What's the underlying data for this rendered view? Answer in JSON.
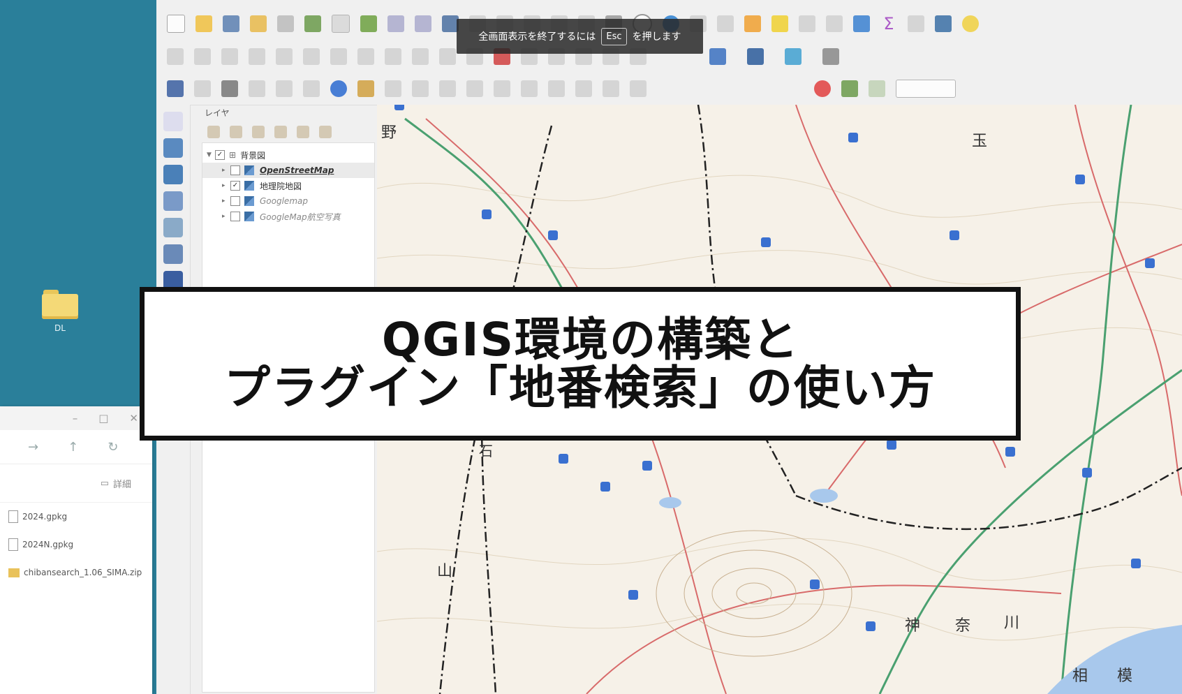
{
  "desktop": {
    "folder_label": "DL"
  },
  "explorer": {
    "window_buttons": [
      "–",
      "□",
      "✕"
    ],
    "details_label": "詳細",
    "files": [
      "2024.gpkg",
      "2024N.gpkg",
      "chibansearch_1.06_SIMA.zip"
    ]
  },
  "overlay": {
    "esc_prefix": "全画面表示を終了するには",
    "esc_key": "Esc",
    "esc_suffix": "を押します"
  },
  "qgis": {
    "layers_panel_title": "レイヤ",
    "layer_group": "背景図",
    "layers": [
      {
        "name": "OpenStreetMap",
        "checked": false
      },
      {
        "name": "地理院地図",
        "checked": true
      },
      {
        "name": "Googlemap",
        "checked": false
      },
      {
        "name": "GoogleMap航空写真",
        "checked": false
      }
    ]
  },
  "map_labels": [
    "野",
    "玉",
    "神",
    "奈",
    "川",
    "山",
    "石",
    "相",
    "模"
  ],
  "title": {
    "line1": "QGIS環境の構築と",
    "line2": "プラグイン「地番検索」の使い方"
  }
}
